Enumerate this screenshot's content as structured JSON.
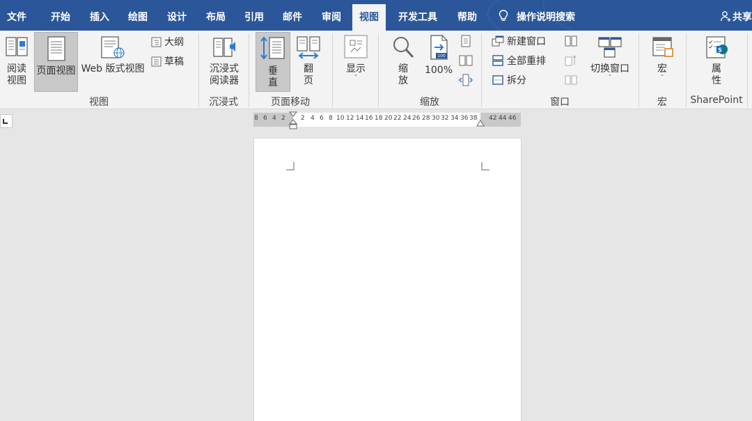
{
  "tabs": [
    {
      "label": "文件"
    },
    {
      "label": "开始"
    },
    {
      "label": "插入"
    },
    {
      "label": "绘图"
    },
    {
      "label": "设计"
    },
    {
      "label": "布局"
    },
    {
      "label": "引用"
    },
    {
      "label": "邮件"
    },
    {
      "label": "审阅"
    },
    {
      "label": "视图"
    },
    {
      "label": "开发工具"
    },
    {
      "label": "帮助"
    }
  ],
  "active_tab": "视图",
  "tell_me": "操作说明搜索",
  "share": "共享",
  "ribbon": {
    "views": {
      "read_mode_1": "阅读",
      "read_mode_2": "视图",
      "print_layout": "页面视图",
      "web_layout": "Web 版式视图",
      "outline": "大纲",
      "draft": "草稿",
      "group": "视图"
    },
    "immersive": {
      "reader_1": "沉浸式",
      "reader_2": "阅读器",
      "group": "沉浸式"
    },
    "page_movement": {
      "vertical_1": "垂",
      "vertical_2": "直",
      "side_1": "翻",
      "side_2": "页",
      "group": "页面移动"
    },
    "show": {
      "label": "显示",
      "chevron": "ˇ"
    },
    "zoom": {
      "zoom_1": "缩",
      "zoom_2": "放",
      "percent": "100%",
      "icon_badge": "100",
      "group": "缩放"
    },
    "window": {
      "new_window": "新建窗口",
      "arrange_all": "全部重排",
      "split": "拆分",
      "switch_windows": "切换窗口",
      "chevron": "ˇ",
      "group": "窗口"
    },
    "macros": {
      "label": "宏",
      "chevron": "ˇ",
      "group": "宏"
    },
    "sharepoint": {
      "prop_1": "属",
      "prop_2": "性",
      "group": "SharePoint"
    }
  },
  "ruler": {
    "left_numbers": [
      "8",
      "6",
      "4",
      "2"
    ],
    "body_numbers": [
      "2",
      "4",
      "6",
      "8",
      "10",
      "12",
      "14",
      "16",
      "18",
      "20",
      "22",
      "24",
      "26",
      "28",
      "30",
      "32",
      "34",
      "36",
      "38"
    ],
    "right_numbers": [
      "42",
      "44",
      "46"
    ]
  },
  "colors": {
    "accent": "#2b579a",
    "ribbon_bg": "#f3f3f3",
    "workspace_bg": "#e6e6e6",
    "pressed_bg": "#c8c8c8"
  }
}
